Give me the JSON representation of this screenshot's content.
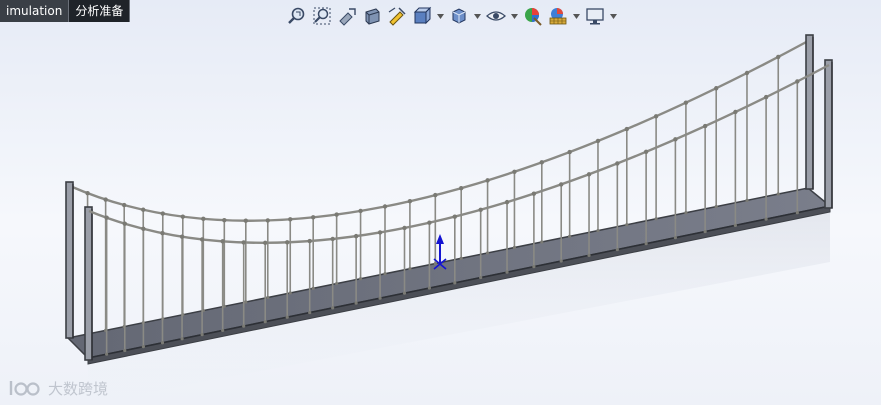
{
  "tabs": [
    {
      "label": "imulation"
    },
    {
      "label": "分析准备"
    }
  ],
  "toolbar": {
    "icons": [
      "zoom-to-fit-icon",
      "zoom-area-icon",
      "previous-view-icon",
      "section-view-icon",
      "dynamic-annotation-icon",
      "view-orientation-icon",
      "display-style-icon",
      "hide-show-items-icon",
      "edit-appearance-icon",
      "apply-scene-icon",
      "view-settings-icon"
    ]
  },
  "watermark": {
    "text": "大数跨境"
  },
  "colors": {
    "background_top": "#e6ebf6",
    "deck": "#6f7380",
    "frame": "#3c3f45",
    "cable": "#8a8a85",
    "triad": "#1414d2"
  }
}
